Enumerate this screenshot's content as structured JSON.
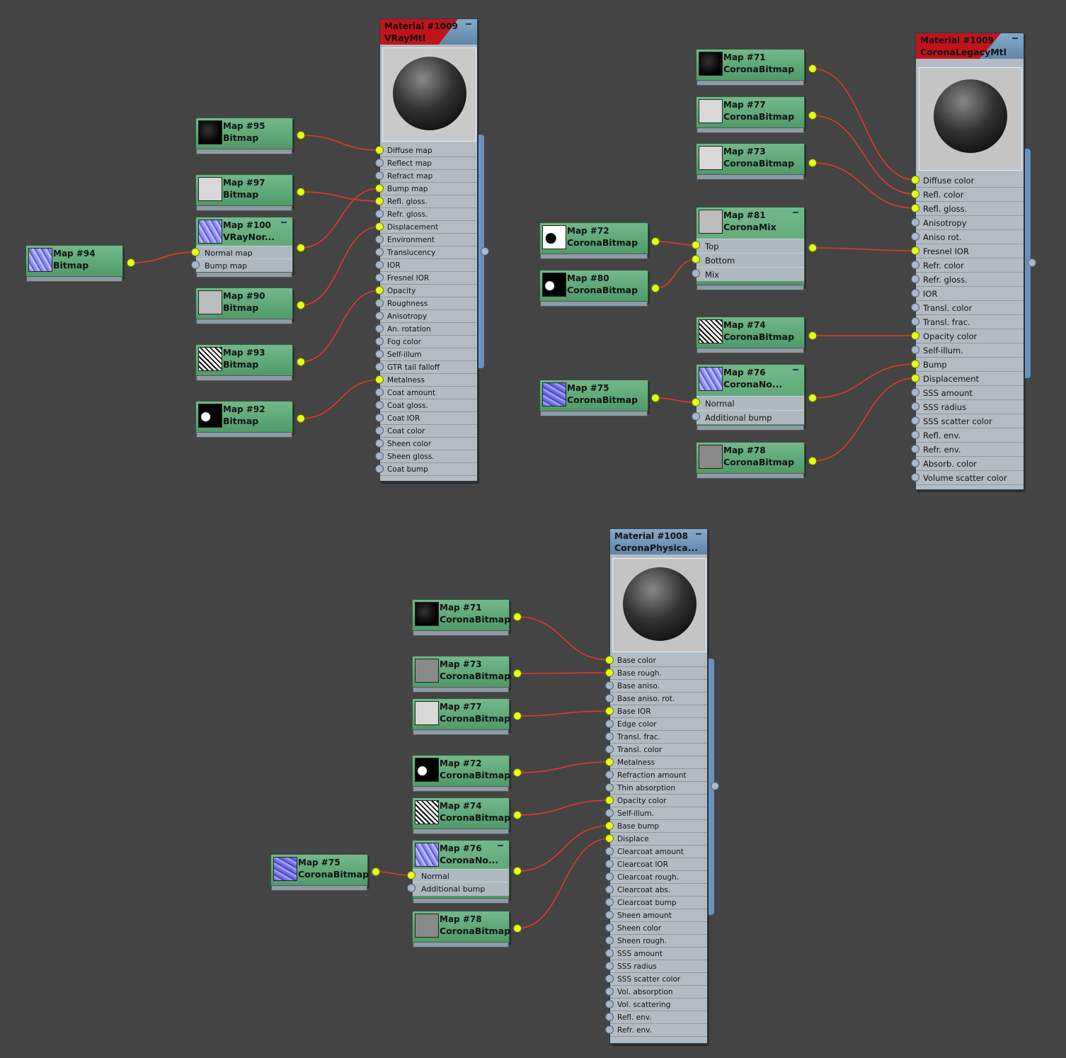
{
  "maps_left": [
    {
      "id": "m95",
      "title": "Map #95",
      "type": "Bitmap",
      "thumb": "dark"
    },
    {
      "id": "m97",
      "title": "Map #97",
      "type": "Bitmap",
      "thumb": "light"
    },
    {
      "id": "m100",
      "title": "Map #100",
      "type": "VRayNor...",
      "thumb": "norm",
      "slots": [
        "Normal map",
        "Bump map"
      ]
    },
    {
      "id": "m90",
      "title": "Map #90",
      "type": "Bitmap",
      "thumb": "mid"
    },
    {
      "id": "m93",
      "title": "Map #93",
      "type": "Bitmap",
      "thumb": "mix"
    },
    {
      "id": "m92",
      "title": "Map #92",
      "type": "Bitmap",
      "thumb": "bwi"
    },
    {
      "id": "m94",
      "title": "Map #94",
      "type": "Bitmap",
      "thumb": "norm"
    }
  ],
  "vray_material": {
    "title": "Material #1009",
    "type": "VRayMtl",
    "slots": [
      "Diffuse map",
      "Reflect map",
      "Refract map",
      "Bump map",
      "Refl. gloss.",
      "Refr. gloss.",
      "Displacement",
      "Environment",
      "Translucency",
      "IOR",
      "Fresnel IOR",
      "Opacity",
      "Roughness",
      "Anisotropy",
      "An. rotation",
      "Fog color",
      "Self-illum",
      "GTR tail falloff",
      "Metalness",
      "Coat amount",
      "Coat gloss.",
      "Coat IOR",
      "Coat color",
      "Sheen color",
      "Sheen gloss.",
      "Coat bump"
    ],
    "connected": [
      0,
      3,
      4,
      6,
      11,
      18
    ]
  },
  "maps_right": [
    {
      "id": "r71",
      "title": "Map #71",
      "type": "CoronaBitmap",
      "thumb": "dark"
    },
    {
      "id": "r77",
      "title": "Map #77",
      "type": "CoronaBitmap",
      "thumb": "light"
    },
    {
      "id": "r73",
      "title": "Map #73",
      "type": "CoronaBitmap",
      "thumb": "light"
    },
    {
      "id": "r72",
      "title": "Map #72",
      "type": "CoronaBitmap",
      "thumb": "bw"
    },
    {
      "id": "r80",
      "title": "Map #80",
      "type": "CoronaBitmap",
      "thumb": "bwi"
    },
    {
      "id": "r81",
      "title": "Map #81",
      "type": "CoronaMix",
      "thumb": "mid",
      "slots": [
        "Top",
        "Bottom",
        "Mix"
      ]
    },
    {
      "id": "r74",
      "title": "Map #74",
      "type": "CoronaBitmap",
      "thumb": "mix"
    },
    {
      "id": "r75",
      "title": "Map #75",
      "type": "CoronaBitmap",
      "thumb": "blue"
    },
    {
      "id": "r76",
      "title": "Map #76",
      "type": "CoronaNo...",
      "thumb": "norm",
      "slots": [
        "Normal",
        "Additional bump"
      ]
    },
    {
      "id": "r78",
      "title": "Map #78",
      "type": "CoronaBitmap",
      "thumb": "grey"
    }
  ],
  "corona_legacy": {
    "title": "Material #1009",
    "type": "CoronaLegacyMtl",
    "slots": [
      "Diffuse color",
      "Refl. color",
      "Refl. gloss.",
      "Anisotropy",
      "Aniso rot.",
      "Fresnel IOR",
      "Refr. color",
      "Refr. gloss.",
      "IOR",
      "Transl. color",
      "Transl. frac.",
      "Opacity color",
      "Self-illum.",
      "Bump",
      "Displacement",
      "SSS amount",
      "SSS radius",
      "SSS scatter color",
      "Refl. env.",
      "Refr. env.",
      "Absorb. color",
      "Volume scatter color"
    ],
    "connected": [
      0,
      1,
      2,
      5,
      11,
      13,
      14
    ]
  },
  "maps_bottom": [
    {
      "id": "b71",
      "title": "Map #71",
      "type": "CoronaBitmap",
      "thumb": "dark"
    },
    {
      "id": "b73",
      "title": "Map #73",
      "type": "CoronaBitmap",
      "thumb": "grey"
    },
    {
      "id": "b77",
      "title": "Map #77",
      "type": "CoronaBitmap",
      "thumb": "light"
    },
    {
      "id": "b72",
      "title": "Map #72",
      "type": "CoronaBitmap",
      "thumb": "bwi"
    },
    {
      "id": "b74",
      "title": "Map #74",
      "type": "CoronaBitmap",
      "thumb": "mix"
    },
    {
      "id": "b75",
      "title": "Map #75",
      "type": "CoronaBitmap",
      "thumb": "blue"
    },
    {
      "id": "b76",
      "title": "Map #76",
      "type": "CoronaNo...",
      "thumb": "norm",
      "slots": [
        "Normal",
        "Additional bump"
      ]
    },
    {
      "id": "b78",
      "title": "Map #78",
      "type": "CoronaBitmap",
      "thumb": "grey"
    }
  ],
  "corona_physical": {
    "title": "Material #1008",
    "type": "CoronaPhysica...",
    "slots": [
      "Base color",
      "Base rough.",
      "Base aniso.",
      "Base aniso. rot.",
      "Base IOR",
      "Edge color",
      "Transl. frac.",
      "Transl. color",
      "Metalness",
      "Refraction amount",
      "Thin absorption",
      "Opacity color",
      "Self-illum.",
      "Base bump",
      "Displace",
      "Clearcoat amount",
      "Clearcoat IOR",
      "Clearcoat rough.",
      "Clearcoat abs.",
      "Clearcoat bump",
      "Sheen amount",
      "Sheen color",
      "Sheen rough.",
      "SSS amount",
      "SSS radius",
      "SSS scatter color",
      "Vol. absorption",
      "Vol. scattering",
      "Refl. env.",
      "Refr. env."
    ],
    "connected": [
      0,
      1,
      4,
      8,
      11,
      13,
      14
    ]
  },
  "colors": {
    "wire": "#e8392e",
    "dot_on": "#e4ff1c",
    "dot_off": "#a8b8cc",
    "map_node": "#5faa78",
    "material_header": "#6f94b8",
    "accent_red": "#c0141c"
  }
}
